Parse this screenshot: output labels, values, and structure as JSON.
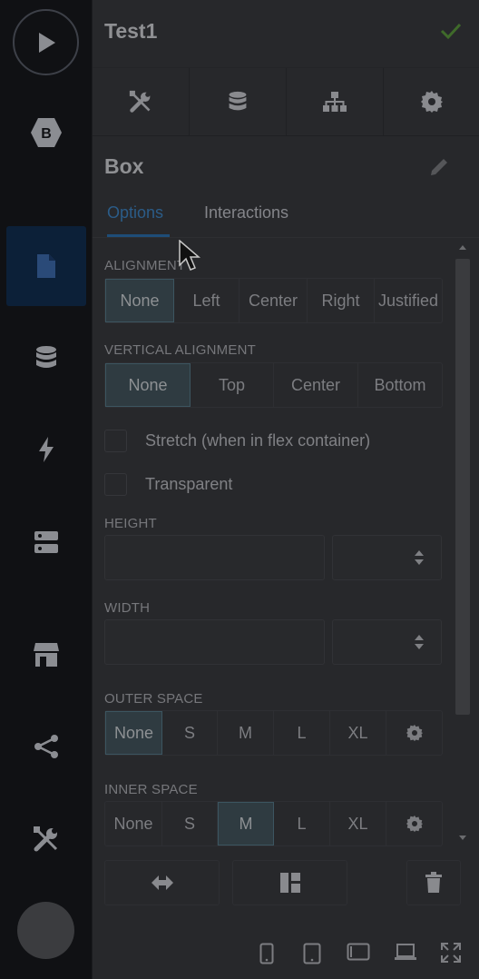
{
  "rail": {
    "items": [
      {
        "icon": "bootstrap-icon"
      },
      {
        "icon": "page-icon",
        "active": true
      },
      {
        "icon": "database-icon"
      },
      {
        "icon": "lightning-icon"
      },
      {
        "icon": "server-icon"
      },
      {
        "icon": "store-icon"
      },
      {
        "icon": "share-icon"
      },
      {
        "icon": "tools-icon"
      }
    ]
  },
  "header": {
    "title": "Test1"
  },
  "toptabs": [
    {
      "icon": "tools-icon"
    },
    {
      "icon": "database-icon"
    },
    {
      "icon": "sitemap-icon"
    },
    {
      "icon": "gear-icon"
    }
  ],
  "section": {
    "title": "Box"
  },
  "subtabs": {
    "options": "Options",
    "interactions": "Interactions",
    "active": "Options"
  },
  "alignment": {
    "label": "ALIGNMENT",
    "options": [
      "None",
      "Left",
      "Center",
      "Right",
      "Justified"
    ],
    "selected": "None"
  },
  "vertical_alignment": {
    "label": "VERTICAL ALIGNMENT",
    "options": [
      "None",
      "Top",
      "Center",
      "Bottom"
    ],
    "selected": "None"
  },
  "checkboxes": {
    "stretch": {
      "label": "Stretch (when in flex container)",
      "checked": false
    },
    "transparent": {
      "label": "Transparent",
      "checked": false
    }
  },
  "height": {
    "label": "HEIGHT",
    "value": "",
    "unit": ""
  },
  "width": {
    "label": "WIDTH",
    "value": "",
    "unit": ""
  },
  "outer_space": {
    "label": "OUTER SPACE",
    "options": [
      "None",
      "S",
      "M",
      "L",
      "XL"
    ],
    "selected": "None"
  },
  "inner_space": {
    "label": "INNER SPACE",
    "options": [
      "None",
      "S",
      "M",
      "L",
      "XL"
    ],
    "selected": "M"
  },
  "colors": {
    "accent": "#1e4d78",
    "check": "#3f6a2a",
    "rail_active": "#0c2038"
  }
}
